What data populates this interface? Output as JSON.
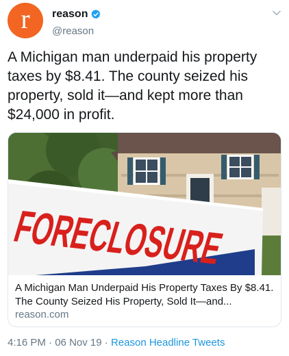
{
  "account": {
    "avatar_letter": "r",
    "display_name": "reason",
    "handle": "@reason",
    "verified": true,
    "avatar_color": "#f26522",
    "verified_color": "#1da1f2"
  },
  "tweet": {
    "text": "A Michigan man underpaid his property taxes by $8.41. The county seized his property, sold it—and kept more than $24,000 in profit."
  },
  "card": {
    "image_sign_text": "FORECLOSURE",
    "title": "A Michigan Man Underpaid His Property Taxes By $8.41. The County Seized His Property, Sold It—and...",
    "domain": "reason.com"
  },
  "footer": {
    "time": "4:16 PM",
    "separator1": " · ",
    "date": "06 Nov 19",
    "separator2": " · ",
    "source": "Reason Headline Tweets"
  },
  "icons": {
    "verified": "verified-badge-icon",
    "caret": "chevron-down-icon"
  }
}
